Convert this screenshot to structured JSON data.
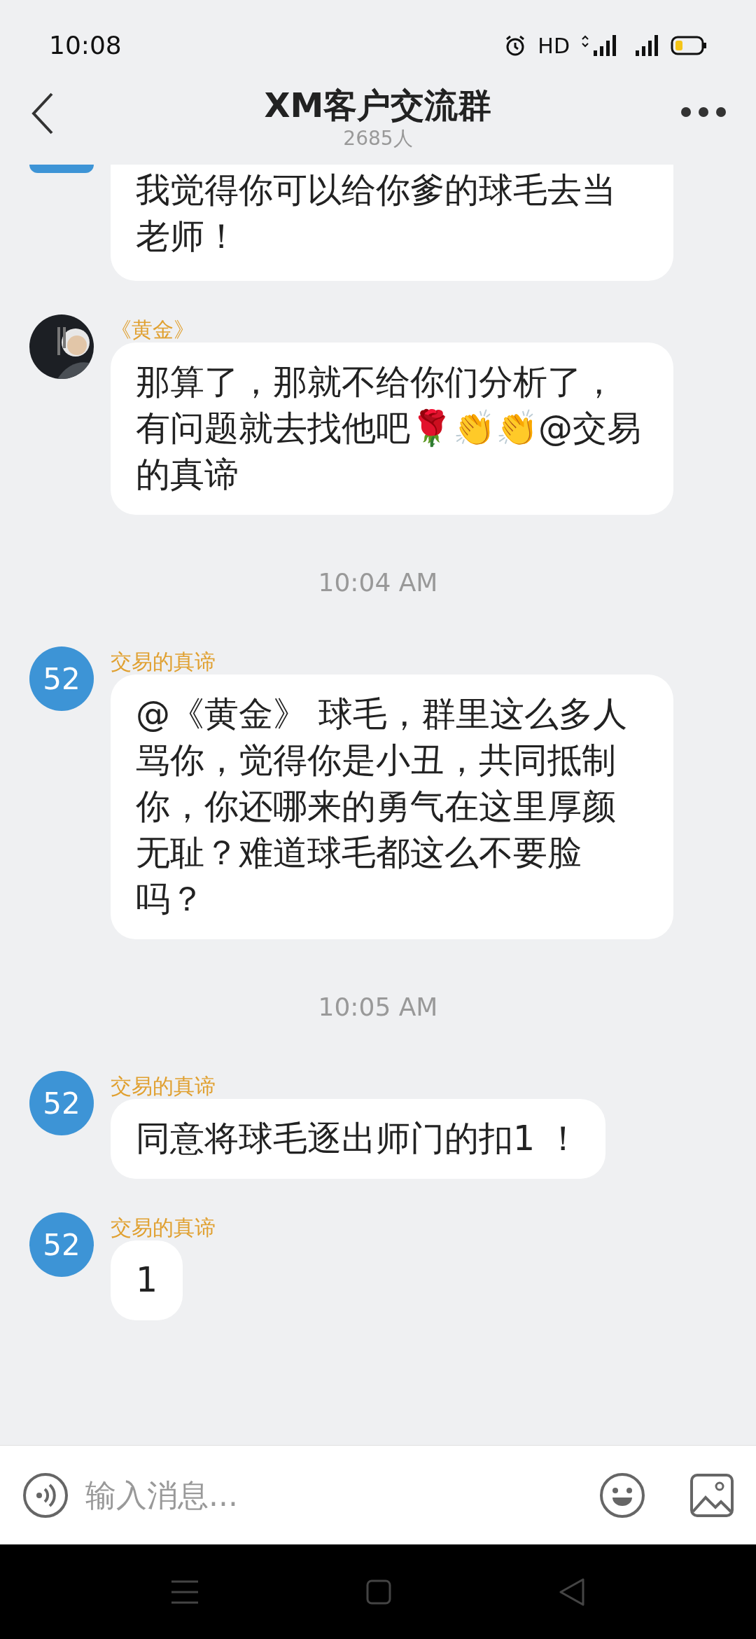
{
  "status_bar": {
    "time": "10:08",
    "hd": "HD"
  },
  "header": {
    "title": "XM客户交流群",
    "subtitle": "2685人"
  },
  "messages": [
    {
      "kind": "cut",
      "text": "我觉得你可以给你爹的球毛去当老师！"
    },
    {
      "kind": "message",
      "sender": "《黄金》",
      "text": "那算了，那就不给你们分析了，有问题就去找他吧🌹👏👏@交易的真谛"
    },
    {
      "kind": "time",
      "text": "10:04 AM"
    },
    {
      "kind": "message",
      "sender": "交易的真谛",
      "avatar": {
        "kind": "number",
        "text": "52"
      },
      "text": "@《黄金》 球毛，群里这么多人骂你，觉得你是小丑，共同抵制你，你还哪来的勇气在这里厚颜无耻？难道球毛都这么不要脸吗？"
    },
    {
      "kind": "time",
      "text": "10:05 AM"
    },
    {
      "kind": "message",
      "sender": "交易的真谛",
      "avatar": {
        "kind": "number",
        "text": "52"
      },
      "text": "同意将球毛逐出师门的扣1 ！"
    },
    {
      "kind": "message",
      "sender": "交易的真谛",
      "avatar": {
        "kind": "number",
        "text": "52"
      },
      "text": "1"
    }
  ],
  "input": {
    "placeholder": "输入消息..."
  }
}
